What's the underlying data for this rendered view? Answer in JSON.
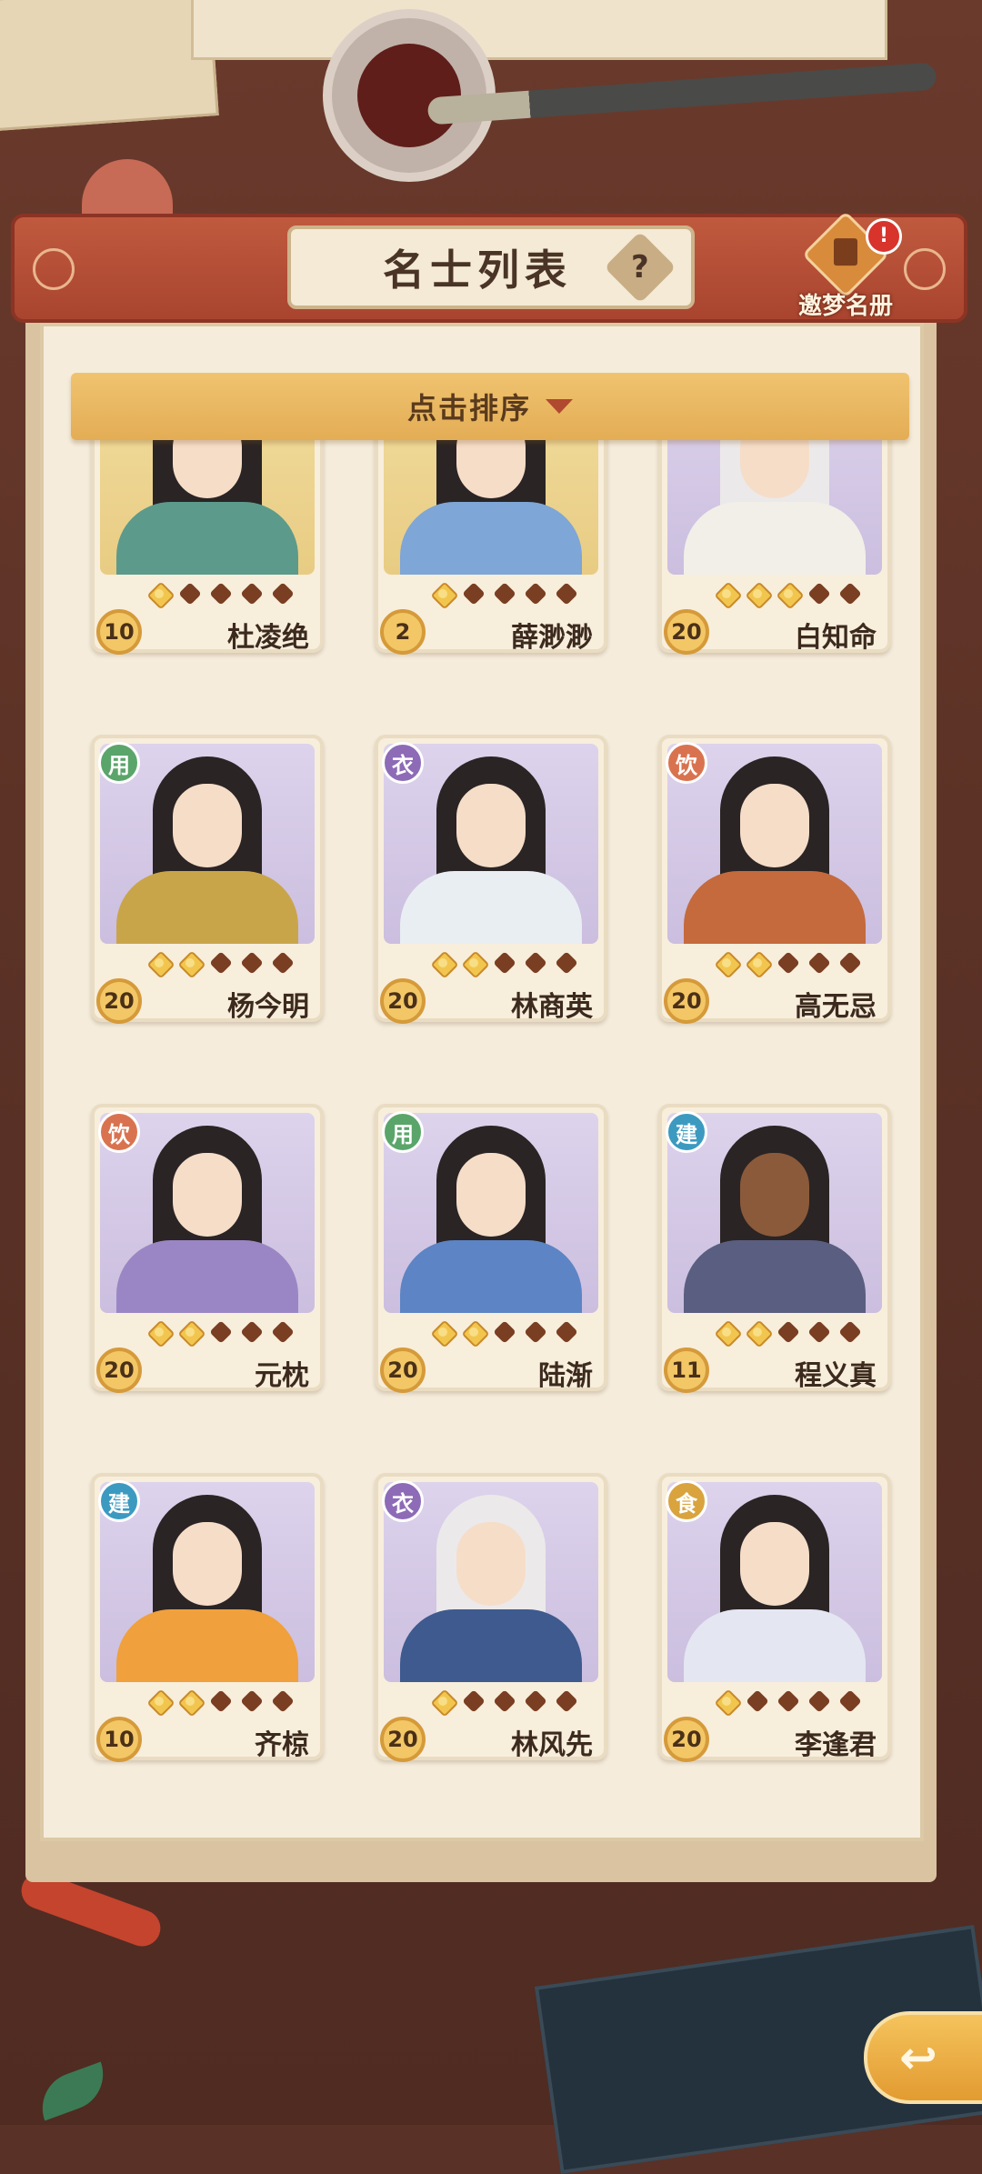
{
  "header": {
    "title": "名士列表",
    "help_label": "?",
    "dream_book_label": "邀梦名册",
    "alert_badge": "!"
  },
  "sort": {
    "label": "点击排序"
  },
  "tag_colors": {
    "用": "#5aa56a",
    "衣": "#8d6bb6",
    "饮": "#d9734f",
    "建": "#3c9ac0",
    "食": "#d9a33e"
  },
  "cards": [
    {
      "name": "杜凌绝",
      "level": "10",
      "stars": 1,
      "tag": "",
      "bg": "gold",
      "robe": "#5c9a8c",
      "hair": "black",
      "face": "light"
    },
    {
      "name": "薛渺渺",
      "level": "2",
      "stars": 1,
      "tag": "",
      "bg": "gold",
      "robe": "#7ea6d6",
      "hair": "black",
      "face": "light"
    },
    {
      "name": "白知命",
      "level": "20",
      "stars": 3,
      "tag": "",
      "bg": "silver",
      "robe": "#f2efe8",
      "hair": "white",
      "face": "light"
    },
    {
      "name": "杨今明",
      "level": "20",
      "stars": 2,
      "tag": "用",
      "bg": "silver",
      "robe": "#c9a54a",
      "hair": "black",
      "face": "light"
    },
    {
      "name": "林商英",
      "level": "20",
      "stars": 2,
      "tag": "衣",
      "bg": "silver",
      "robe": "#e9eef2",
      "hair": "black",
      "face": "light"
    },
    {
      "name": "高无忌",
      "level": "20",
      "stars": 2,
      "tag": "饮",
      "bg": "silver",
      "robe": "#c46a3c",
      "hair": "black",
      "face": "light"
    },
    {
      "name": "元枕",
      "level": "20",
      "stars": 2,
      "tag": "饮",
      "bg": "silver",
      "robe": "#9a86c4",
      "hair": "black",
      "face": "light"
    },
    {
      "name": "陆渐",
      "level": "20",
      "stars": 2,
      "tag": "用",
      "bg": "silver",
      "robe": "#5d84c4",
      "hair": "black",
      "face": "light"
    },
    {
      "name": "程义真",
      "level": "11",
      "stars": 2,
      "tag": "建",
      "bg": "silver",
      "robe": "#5a5e80",
      "hair": "black",
      "face": "dark"
    },
    {
      "name": "齐椋",
      "level": "10",
      "stars": 2,
      "tag": "建",
      "bg": "silver",
      "robe": "#f0a03c",
      "hair": "black",
      "face": "light"
    },
    {
      "name": "林风先",
      "level": "20",
      "stars": 1,
      "tag": "衣",
      "bg": "silver",
      "robe": "#3e5a8e",
      "hair": "white",
      "face": "light"
    },
    {
      "name": "李逢君",
      "level": "20",
      "stars": 1,
      "tag": "食",
      "bg": "silver",
      "robe": "#e4e6f2",
      "hair": "black",
      "face": "light"
    }
  ],
  "back_label": "↩"
}
